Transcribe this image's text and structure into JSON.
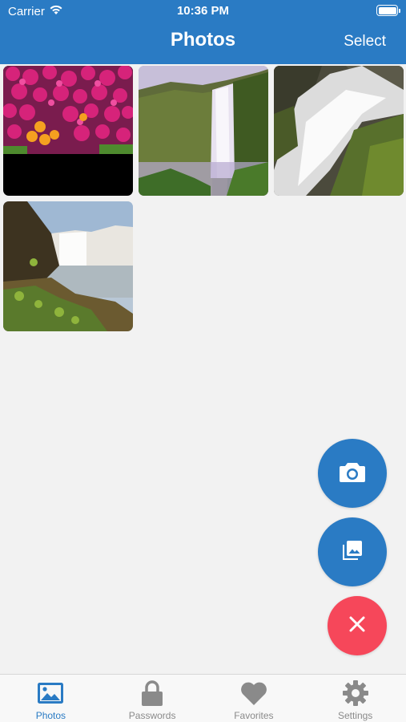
{
  "status_bar": {
    "carrier": "Carrier",
    "time": "10:36 PM"
  },
  "header": {
    "title": "Photos",
    "select_label": "Select"
  },
  "photos": [
    {
      "name": "magenta flowers"
    },
    {
      "name": "waterfall cliff"
    },
    {
      "name": "waterfall rocks"
    },
    {
      "name": "waterfall river"
    }
  ],
  "fabs": {
    "camera_icon": "camera-icon",
    "gallery_icon": "photo-library-icon",
    "close_icon": "close-icon"
  },
  "tabs": [
    {
      "label": "Photos",
      "icon": "image-icon",
      "active": true
    },
    {
      "label": "Passwords",
      "icon": "lock-icon",
      "active": false
    },
    {
      "label": "Favorites",
      "icon": "heart-icon",
      "active": false
    },
    {
      "label": "Settings",
      "icon": "gear-icon",
      "active": false
    }
  ],
  "colors": {
    "primary": "#2a7bc4",
    "danger": "#f6475a",
    "background": "#f2f2f2",
    "inactive_tab": "#8a8a8a"
  }
}
